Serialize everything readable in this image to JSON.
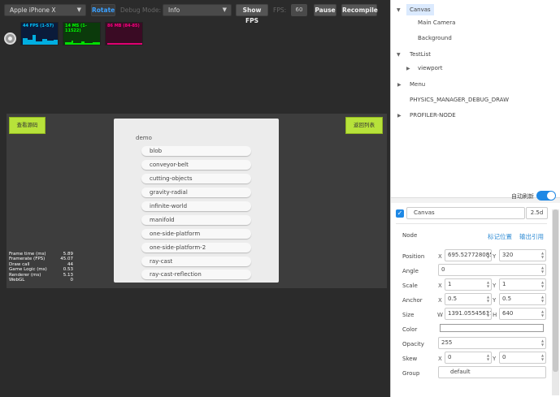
{
  "toolbar": {
    "device": "Apple iPhone X",
    "rotate": "Rotate",
    "debug_mode_label": "Debug Mode:",
    "debug_mode_value": "Info",
    "show_fps": "Show FPS",
    "fps_label": "FPS:",
    "fps_value": "60",
    "pause": "Pause",
    "recompile": "Recompile"
  },
  "stats": {
    "fps": "44 FPS (1-57)",
    "ms": "14 MS (1-11522)",
    "mb": "86 MB (84-85)"
  },
  "game": {
    "left_button": "查看源码",
    "right_button": "返回列表",
    "menu_title": "demo",
    "menu_items": [
      "blob",
      "conveyor-belt",
      "cutting-objects",
      "gravity-radial",
      "infinite-world",
      "manifold",
      "one-side-platform",
      "one-side-platform-2",
      "ray-cast",
      "ray-cast-reflection"
    ]
  },
  "perf": [
    {
      "label": "Frame time (ms)",
      "value": "5.89"
    },
    {
      "label": "Framerate (FPS)",
      "value": "45.07"
    },
    {
      "label": "Draw call",
      "value": "44"
    },
    {
      "label": "Game Logic (ms)",
      "value": "0.53"
    },
    {
      "label": "Renderer (ms)",
      "value": "5.13"
    },
    {
      "label": "WebGL",
      "value": "0"
    }
  ],
  "tree": {
    "canvas": "Canvas",
    "main_camera": "Main Camera",
    "background": "Background",
    "testlist": "TestList",
    "viewport": "viewport",
    "menu": "Menu",
    "physics": "PHYSICS_MANAGER_DEBUG_DRAW",
    "profiler": "PROFILER-NODE",
    "auto_refresh": "自动刷新"
  },
  "inspector": {
    "name": "Canvas",
    "mode": "2.5d",
    "section": "Node",
    "link_mark": "标记位置",
    "link_output": "输出引用",
    "position_label": "Position",
    "position_x": "695.527728085",
    "position_y": "320",
    "angle_label": "Angle",
    "angle": "0",
    "scale_label": "Scale",
    "scale_x": "1",
    "scale_y": "1",
    "anchor_label": "Anchor",
    "anchor_x": "0.5",
    "anchor_y": "0.5",
    "size_label": "Size",
    "size_w": "1391.05545617",
    "size_h": "640",
    "color_label": "Color",
    "opacity_label": "Opacity",
    "opacity": "255",
    "skew_label": "Skew",
    "skew_x": "0",
    "skew_y": "0",
    "group_label": "Group",
    "group": "default",
    "axis_x": "X",
    "axis_y": "Y",
    "axis_w": "W",
    "axis_h": "H"
  },
  "colors": {
    "accent": "#1e88e5",
    "game_button": "#b7e23a",
    "fps_graph": "#00c8ff",
    "ms_graph": "#00ff00",
    "mb_graph": "#ff0080"
  }
}
